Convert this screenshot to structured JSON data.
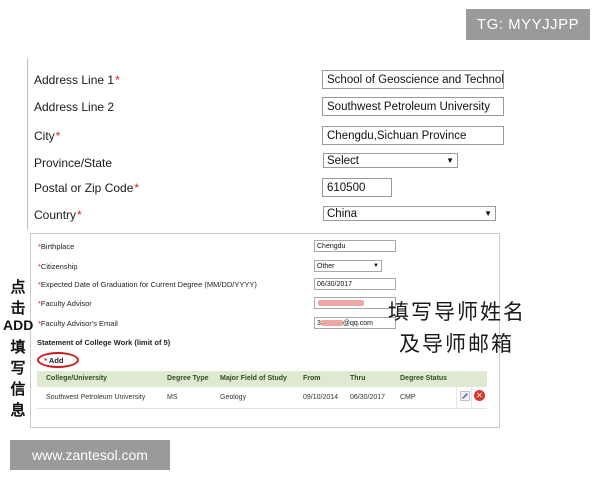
{
  "watermarks": {
    "tg": "TG: MYYJJPP",
    "site": "www.zantesol.com"
  },
  "address_form": {
    "required_mark": "*",
    "fields": [
      {
        "label": "Address Line 1",
        "required": true,
        "value": "School of Geoscience and Technolo"
      },
      {
        "label": "Address Line 2",
        "required": false,
        "value": "Southwest Petroleum University"
      },
      {
        "label": "City",
        "required": true,
        "value": "Chengdu,Sichuan Province"
      },
      {
        "label": "Province/State",
        "required": false,
        "value": "Select"
      },
      {
        "label": "Postal or Zip Code",
        "required": true,
        "value": "610500"
      },
      {
        "label": "Country",
        "required": true,
        "value": "China"
      }
    ]
  },
  "detail_form": {
    "fields": [
      {
        "label": "Birthplace",
        "value": "Chengdu"
      },
      {
        "label": "Citizenship",
        "value": "Other"
      },
      {
        "label": "Expected Date of Graduation for Current Degree (MM/DD/YYYY)",
        "value": "06/30/2017"
      },
      {
        "label": "Faculty Advisor",
        "value": ""
      },
      {
        "label": "Faculty Advisor's Email",
        "value_prefix": "3",
        "value_suffix": "@qq.com"
      }
    ],
    "section_title": "Statement of College Work (limit of 5)",
    "add_label": "Add",
    "table": {
      "headers": [
        "College/University",
        "Degree Type",
        "Major Field of Study",
        "From",
        "Thru",
        "Degree Status"
      ],
      "rows": [
        [
          "Southwest Petroleum University",
          "MS",
          "Geology",
          "09/10/2014",
          "06/30/2017",
          "CMP"
        ]
      ]
    }
  },
  "annotations": {
    "left_vertical": [
      "点",
      "击",
      "ADD",
      "填",
      "写",
      "信",
      "息"
    ],
    "right_line1": "填写导师姓名",
    "right_line2": "及导师邮箱"
  },
  "colors": {
    "required": "#d32222",
    "highlight_oval": "#c81c1c",
    "table_header_bg": "#dfe8d1",
    "redaction": "#e88a8a"
  },
  "icons": {
    "row_edit": "pencil-icon",
    "row_delete": "delete-icon",
    "select_arrow": "triangle-down-icon"
  }
}
